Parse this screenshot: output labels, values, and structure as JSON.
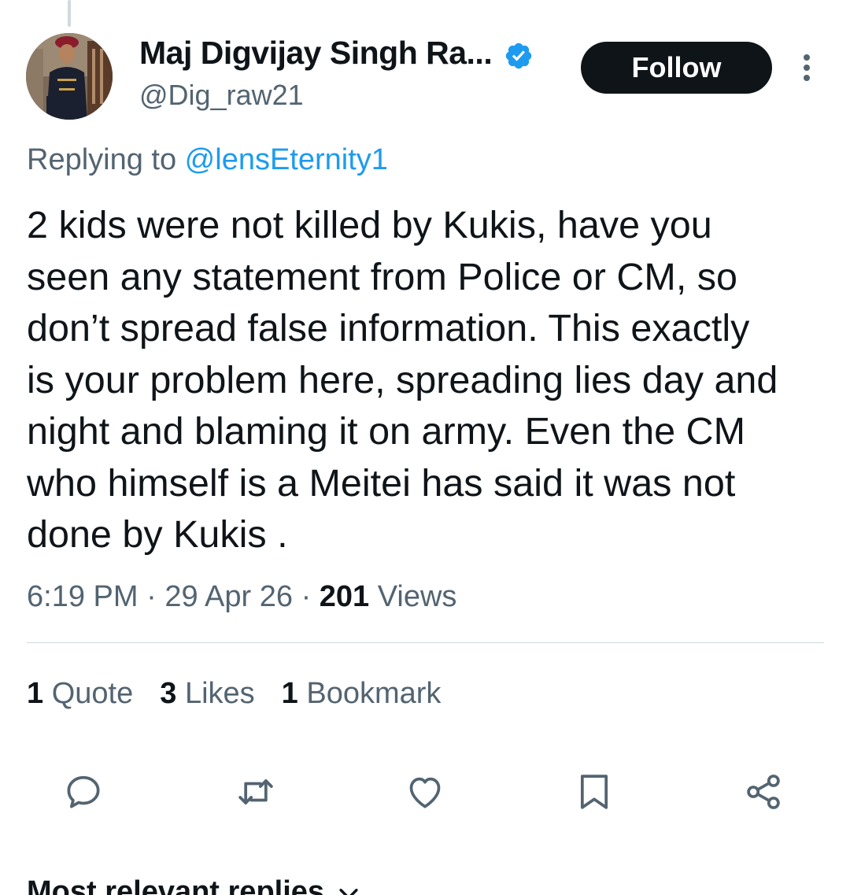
{
  "author": {
    "display_name": "Maj Digvijay Singh Ra...",
    "handle": "@Dig_raw21",
    "verified": true
  },
  "follow_label": "Follow",
  "reply_context": {
    "prefix": "Replying to ",
    "mention": "@lensEternity1"
  },
  "tweet": {
    "lines": [
      "2 kids were not killed by Kukis, have you",
      "seen any statement from Police or CM, so",
      "don’t spread false information. This exactly",
      "is your problem here, spreading lies day and",
      "night and blaming it on army. Even the CM",
      "who himself is a Meitei has said it was not",
      "done by Kukis ."
    ]
  },
  "meta": {
    "time": "6:19 PM",
    "separator": "·",
    "date": "29 Apr 26",
    "views_count": "201",
    "views_label": "Views"
  },
  "stats": {
    "quotes_count": "1",
    "quotes_label": "Quote",
    "likes_count": "3",
    "likes_label": "Likes",
    "bookmarks_count": "1",
    "bookmarks_label": "Bookmark"
  },
  "actions": [
    "reply-icon",
    "retweet-icon",
    "like-icon",
    "bookmark-icon",
    "share-icon"
  ],
  "replies_heading": "Most relevant replies",
  "colors": {
    "text_primary": "#0f1419",
    "text_secondary": "#536471",
    "link": "#1d9bf0",
    "divider": "#cfd9de",
    "follow_bg": "#0f1419",
    "verified": "#1d9bf0"
  }
}
